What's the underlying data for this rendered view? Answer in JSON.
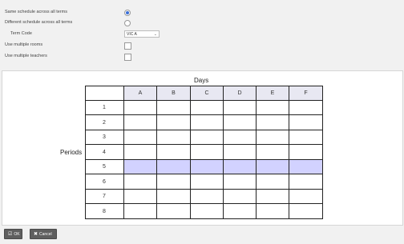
{
  "options": {
    "same_schedule_label": "Same schedule across all terms",
    "different_schedule_label": "Different schedule across all terms",
    "term_code_label": "Term Code",
    "term_code_value": "VIC A",
    "multiple_rooms_label": "Use multiple rooms",
    "multiple_teachers_label": "Use multiple teachers",
    "same_schedule_selected": true
  },
  "grid": {
    "days_label": "Days",
    "periods_label": "Periods",
    "days": [
      "A",
      "B",
      "C",
      "D",
      "E",
      "F"
    ],
    "periods": [
      "1",
      "2",
      "3",
      "4",
      "5",
      "6",
      "7",
      "8"
    ],
    "selected_period": "5"
  },
  "footer": {
    "ok_label": "OK",
    "cancel_label": "Cancel"
  },
  "icons": {
    "ok": "check-icon",
    "cancel": "close-icon",
    "select": "chevron-down-icon"
  },
  "colors": {
    "selected_row": "#d2d2ff",
    "header_fill": "#e8e8f2",
    "radio_accent": "#3b6fd8",
    "button": "#5f5f5f"
  }
}
